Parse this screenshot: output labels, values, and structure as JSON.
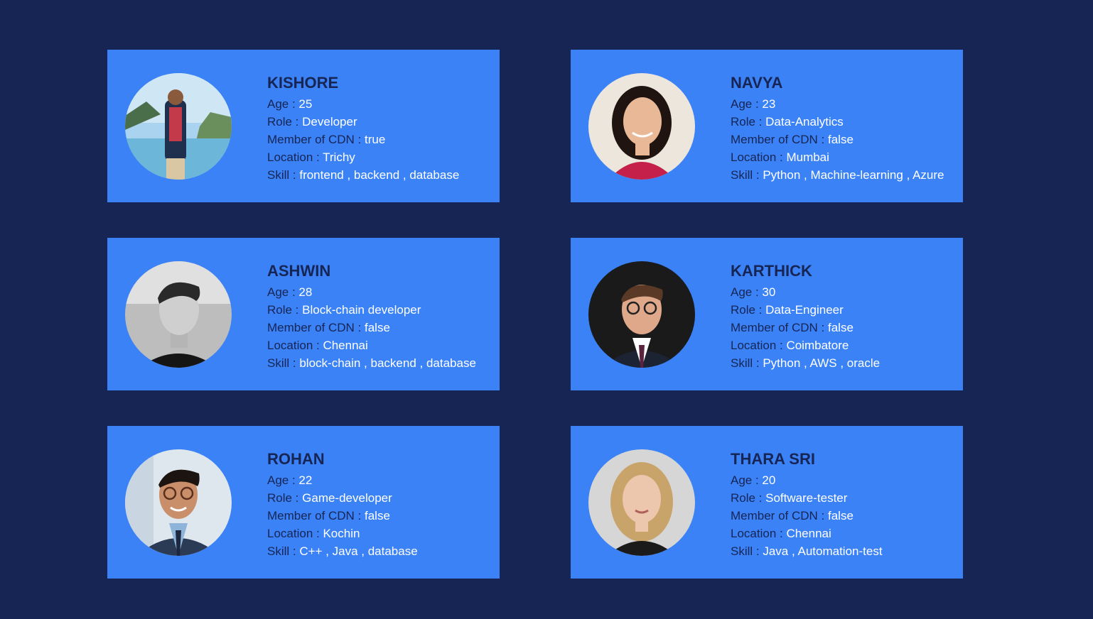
{
  "labels": {
    "age": "Age : ",
    "role": "Role : ",
    "member": "Member of CDN : ",
    "location": "Location : ",
    "skill": "Skill : "
  },
  "colors": {
    "background": "#172554",
    "card": "#3b82f6",
    "label": "#172554",
    "value": "#ffffff"
  },
  "profiles": [
    {
      "name": "KISHORE",
      "age": "25",
      "role": "Developer",
      "member": "true",
      "location": "Trichy",
      "skill": "frontend , backend , database",
      "photo": "avatar-photo-outdoor-lake"
    },
    {
      "name": "NAVYA",
      "age": "23",
      "role": "Data-Analytics",
      "member": "false",
      "location": "Mumbai",
      "skill": "Python , Machine-learning , Azure",
      "photo": "avatar-photo-woman-red-top"
    },
    {
      "name": "ASHWIN",
      "age": "28",
      "role": "Block-chain developer",
      "member": "false",
      "location": "Chennai",
      "skill": "block-chain , backend , database",
      "photo": "avatar-photo-man-grayscale"
    },
    {
      "name": "KARTHICK",
      "age": "30",
      "role": "Data-Engineer",
      "member": "false",
      "location": "Coimbatore",
      "skill": "Python , AWS , oracle",
      "photo": "avatar-photo-man-glasses-suit"
    },
    {
      "name": "ROHAN",
      "age": "22",
      "role": "Game-developer",
      "member": "false",
      "location": "Kochin",
      "skill": "C++ , Java , database",
      "photo": "avatar-photo-man-glasses-blazer"
    },
    {
      "name": "THARA SRI",
      "age": "20",
      "role": "Software-tester",
      "member": "false",
      "location": "Chennai",
      "skill": "Java , Automation-test",
      "photo": "avatar-photo-woman-blonde"
    }
  ]
}
